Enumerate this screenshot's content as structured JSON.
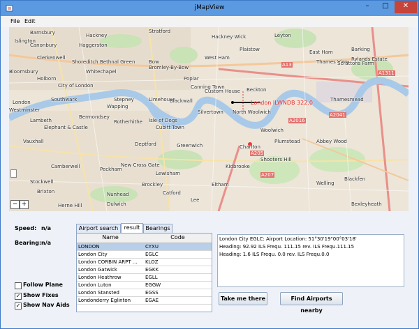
{
  "window": {
    "title": "jMapView",
    "minimize": "–",
    "maximize": "□",
    "close": "✕"
  },
  "menu": {
    "file": "File",
    "edit": "Edit"
  },
  "map": {
    "labels": [
      "Barnsbury",
      "Stratford",
      "Hackney",
      "Islington",
      "Haggerston",
      "Hackney Wick",
      "Canonbury",
      "Leyton",
      "Clerkenwell",
      "Shoreditch",
      "Bethnal Green",
      "Bow",
      "Plaistow",
      "East Ham",
      "Bromley-By-Bow",
      "West Ham",
      "Bloomsbury",
      "Barking",
      "Rylands Estate",
      "Thames View",
      "Scrattons Farm",
      "City of London",
      "Holborn",
      "Whitechapel",
      "Poplar",
      "London",
      "Southwark",
      "Canning Town",
      "Custom House",
      "Beckton",
      "Westminster",
      "Wapping",
      "Limehouse",
      "Stepney",
      "Blackwall",
      "Thamesmead",
      "Lambeth",
      "Bermondsey",
      "Rotherhithe",
      "Isle of Dogs",
      "Silvertown",
      "North Woolwich",
      "Elephant & Castle",
      "Cubitt Town",
      "Woolwich",
      "Vauxhall",
      "Deptford",
      "Greenwich",
      "Charlton",
      "Plumstead",
      "Abbey Wood",
      "Stockwell",
      "Camberwell",
      "Peckham",
      "New Cross Gate",
      "Lewisham",
      "Kidbrooke",
      "Shooters Hill",
      "Welling",
      "Brixton",
      "Nunhead",
      "Catford",
      "Eltham",
      "Blackfen",
      "Dulwich",
      "Bexleyheath",
      "Herne Hill",
      "Lee",
      "Brockley"
    ],
    "runway_label": "London ILWNDB 322.0",
    "road_labels": [
      "A13",
      "A1311",
      "A2041",
      "A2016",
      "A205",
      "A207"
    ],
    "zoom_in": "+",
    "zoom_out": "−"
  },
  "info": {
    "speed_label": "Speed:",
    "speed_value": "n/a",
    "bearing_label": "Bearing:",
    "bearing_value": "n/a"
  },
  "tabs": [
    "Airport search",
    "result",
    "Bearings"
  ],
  "selected_tab": "result",
  "table": {
    "columns": [
      "Name",
      "Code"
    ],
    "rows": [
      [
        "LONDON",
        "CYXU"
      ],
      [
        "London City",
        "EGLC"
      ],
      [
        "London CORBIN ARPT ...",
        "KLOZ"
      ],
      [
        "London Gatwick",
        "EGKK"
      ],
      [
        "London Heathrow",
        "EGLL"
      ],
      [
        "London Luton",
        "EGGW"
      ],
      [
        "London Stansted",
        "EGSS"
      ],
      [
        "Londonderry Eglinton",
        "EGAE"
      ]
    ],
    "selected_row": 0
  },
  "result": {
    "lines": [
      "London City  EGLC:  Airport Location: 51°30'19\"00°03'18'",
      "    Heading: 92.92 ILS Frequ. 111.15 rev. ILS Frequ.111.15",
      "    Heading: 1.6 ILS Frequ. 0.0 rev. ILS Frequ.0.0"
    ]
  },
  "buttons": {
    "take_me_there": "Take me there",
    "find_airports": "Find Airports nearby"
  },
  "checkboxes": [
    {
      "label": "Follow Plane",
      "checked": false
    },
    {
      "label": "Show Fixes",
      "checked": true
    },
    {
      "label": "Show Nav Aids",
      "checked": true
    }
  ],
  "colors": {
    "titlebar": "#5b9ae0",
    "close": "#c7443a",
    "thames": "#a9c9e8",
    "selection": "#b8cfe9"
  }
}
